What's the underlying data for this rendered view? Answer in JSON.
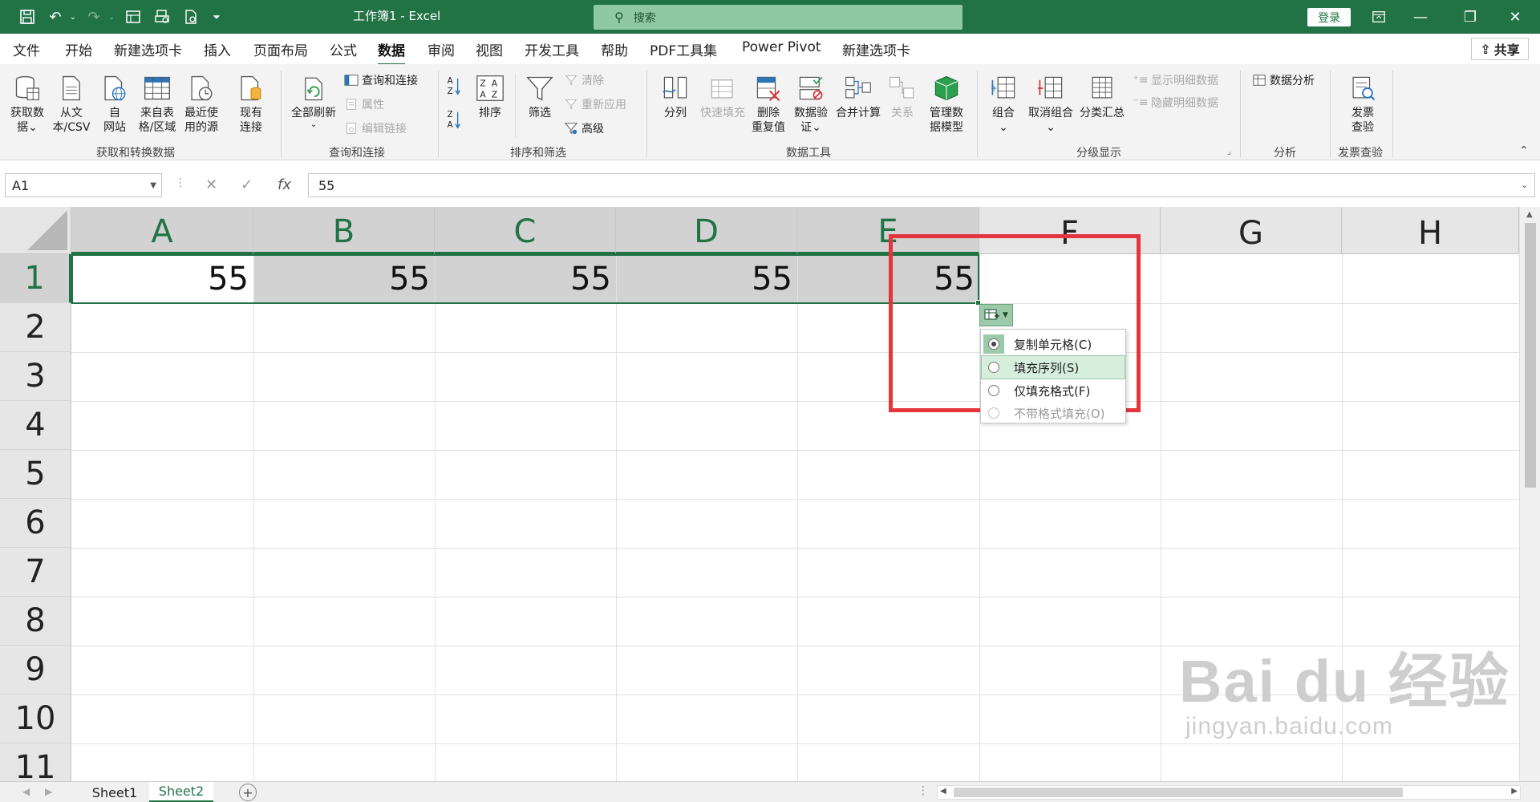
{
  "app": {
    "window_title": "工作簿1  -  Excel",
    "search_placeholder": "搜索",
    "login_label": "登录",
    "share_label": "共享"
  },
  "menu_tabs": [
    "文件",
    "开始",
    "新建选项卡",
    "插入",
    "页面布局",
    "公式",
    "数据",
    "审阅",
    "视图",
    "开发工具",
    "帮助",
    "PDF工具集",
    "Power Pivot",
    "新建选项卡"
  ],
  "active_tab": "数据",
  "ribbon": {
    "get_transform": {
      "label": "获取和转换数据",
      "buttons": [
        "获取数\n据⌄",
        "从文\n本/CSV",
        "自\n网站",
        "来自表\n格/区域",
        "最近使\n用的源",
        "现有\n连接"
      ]
    },
    "query_connect": {
      "label": "查询和连接",
      "refresh_all": "全部刷新",
      "items": [
        "查询和连接",
        "属性",
        "编辑链接"
      ]
    },
    "sort_filter": {
      "label": "排序和筛选",
      "sort": "排序",
      "filter": "筛选",
      "items": [
        "清除",
        "重新应用",
        "高级"
      ]
    },
    "data_tools": {
      "label": "数据工具",
      "buttons": [
        "分列",
        "快速填充",
        "删除\n重复值",
        "数据验\n证⌄",
        "合并计算",
        "关系",
        "管理数\n据模型"
      ]
    },
    "outline": {
      "label": "分级显示",
      "buttons": [
        "组合\n⌄",
        "取消组合\n⌄",
        "分类汇总"
      ],
      "items": [
        "显示明细数据",
        "隐藏明细数据"
      ]
    },
    "analysis": {
      "label": "分析",
      "item": "数据分析"
    },
    "invoice": {
      "label": "发票查验",
      "button": "发票\n查验"
    }
  },
  "formula_bar": {
    "name_box": "A1",
    "formula": "55"
  },
  "columns": [
    "A",
    "B",
    "C",
    "D",
    "E",
    "F",
    "G",
    "H"
  ],
  "rows": [
    "1",
    "2",
    "3",
    "4",
    "5",
    "6",
    "7",
    "8",
    "9",
    "10",
    "11"
  ],
  "cells": {
    "A1": "55",
    "B1": "55",
    "C1": "55",
    "D1": "55",
    "E1": "55"
  },
  "autofill_menu": {
    "items": [
      "复制单元格(C)",
      "填充序列(S)",
      "仅填充格式(F)",
      "不带格式填充(O)"
    ],
    "checked_index": 0,
    "hover_index": 1
  },
  "sheets": [
    "Sheet1",
    "Sheet2"
  ],
  "active_sheet": "Sheet2",
  "watermark": {
    "brand": "Bai du 经验",
    "url": "jingyan.baidu.com"
  },
  "colors": {
    "excel_green": "#217346",
    "highlight_red": "#e5353c"
  }
}
